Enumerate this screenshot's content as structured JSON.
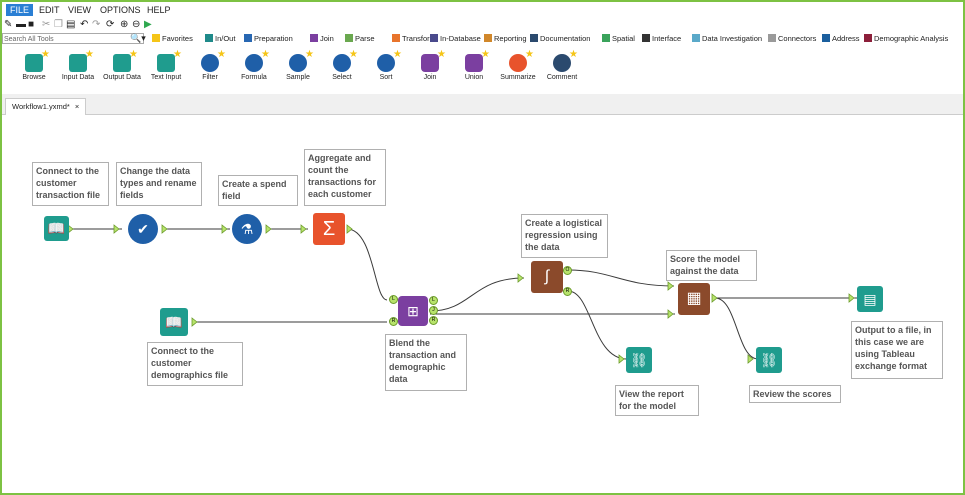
{
  "menu": {
    "file": "FILE",
    "edit": "EDIT",
    "view": "VIEW",
    "options": "OPTIONS",
    "help": "HELP"
  },
  "search": {
    "placeholder": "Search All Tools"
  },
  "categories": [
    {
      "label": "Favorites",
      "color": "#f5c518"
    },
    {
      "label": "In/Out",
      "color": "#1f8a8a"
    },
    {
      "label": "Preparation",
      "color": "#2867b2"
    },
    {
      "label": "Join",
      "color": "#7b3fa0"
    },
    {
      "label": "Parse",
      "color": "#6aa84f"
    },
    {
      "label": "Transform",
      "color": "#e8742c"
    },
    {
      "label": "In-Database",
      "color": "#4a4a8c"
    },
    {
      "label": "Reporting",
      "color": "#d1872a"
    },
    {
      "label": "Documentation",
      "color": "#2b4a6e"
    },
    {
      "label": "Spatial",
      "color": "#3aa35b"
    },
    {
      "label": "Interface",
      "color": "#333333"
    },
    {
      "label": "Data Investigation",
      "color": "#5aa9c9"
    },
    {
      "label": "Connectors",
      "color": "#9a9a9a"
    },
    {
      "label": "Address",
      "color": "#1b5f9e"
    },
    {
      "label": "Demographic Analysis",
      "color": "#8c1f3a"
    }
  ],
  "tools": [
    {
      "label": "Browse",
      "color": "#1f9c8e"
    },
    {
      "label": "Input Data",
      "color": "#1f9c8e"
    },
    {
      "label": "Output Data",
      "color": "#1f9c8e"
    },
    {
      "label": "Text Input",
      "color": "#1f9c8e"
    },
    {
      "label": "Filter",
      "color": "#1f5fa8"
    },
    {
      "label": "Formula",
      "color": "#1f5fa8"
    },
    {
      "label": "Sample",
      "color": "#1f5fa8"
    },
    {
      "label": "Select",
      "color": "#1f5fa8"
    },
    {
      "label": "Sort",
      "color": "#1f5fa8"
    },
    {
      "label": "Join",
      "color": "#7b3fa0"
    },
    {
      "label": "Union",
      "color": "#7b3fa0"
    },
    {
      "label": "Summarize",
      "color": "#e8532c"
    },
    {
      "label": "Comment",
      "color": "#2b4a6e"
    }
  ],
  "tab": {
    "label": "Workflow1.yxmd*",
    "close": "×"
  },
  "notes": {
    "n1": "Connect to the customer transaction file",
    "n2": "Change the data types and rename fields",
    "n3": "Create a spend field",
    "n4": "Aggregate and count the transactions for each customer",
    "n5": "Connect to the customer demographics file",
    "n6": "Blend the transaction and demographic data",
    "n7": "Create a logistical regression using the data",
    "n8": "Score the model against the data",
    "n9": "View the report for the model",
    "n10": "Review the scores",
    "n11": "Output to a file, in this case we are using Tableau exchange format"
  },
  "anchors": {
    "left": "L",
    "join": "J",
    "right": "R",
    "output": "O"
  },
  "colors": {
    "border": "#7dc243",
    "inout": "#1f9c8e",
    "prep": "#1f5fa8",
    "join": "#7b3fa0",
    "transform": "#e8532c",
    "predictive": "#8b4a2b"
  }
}
